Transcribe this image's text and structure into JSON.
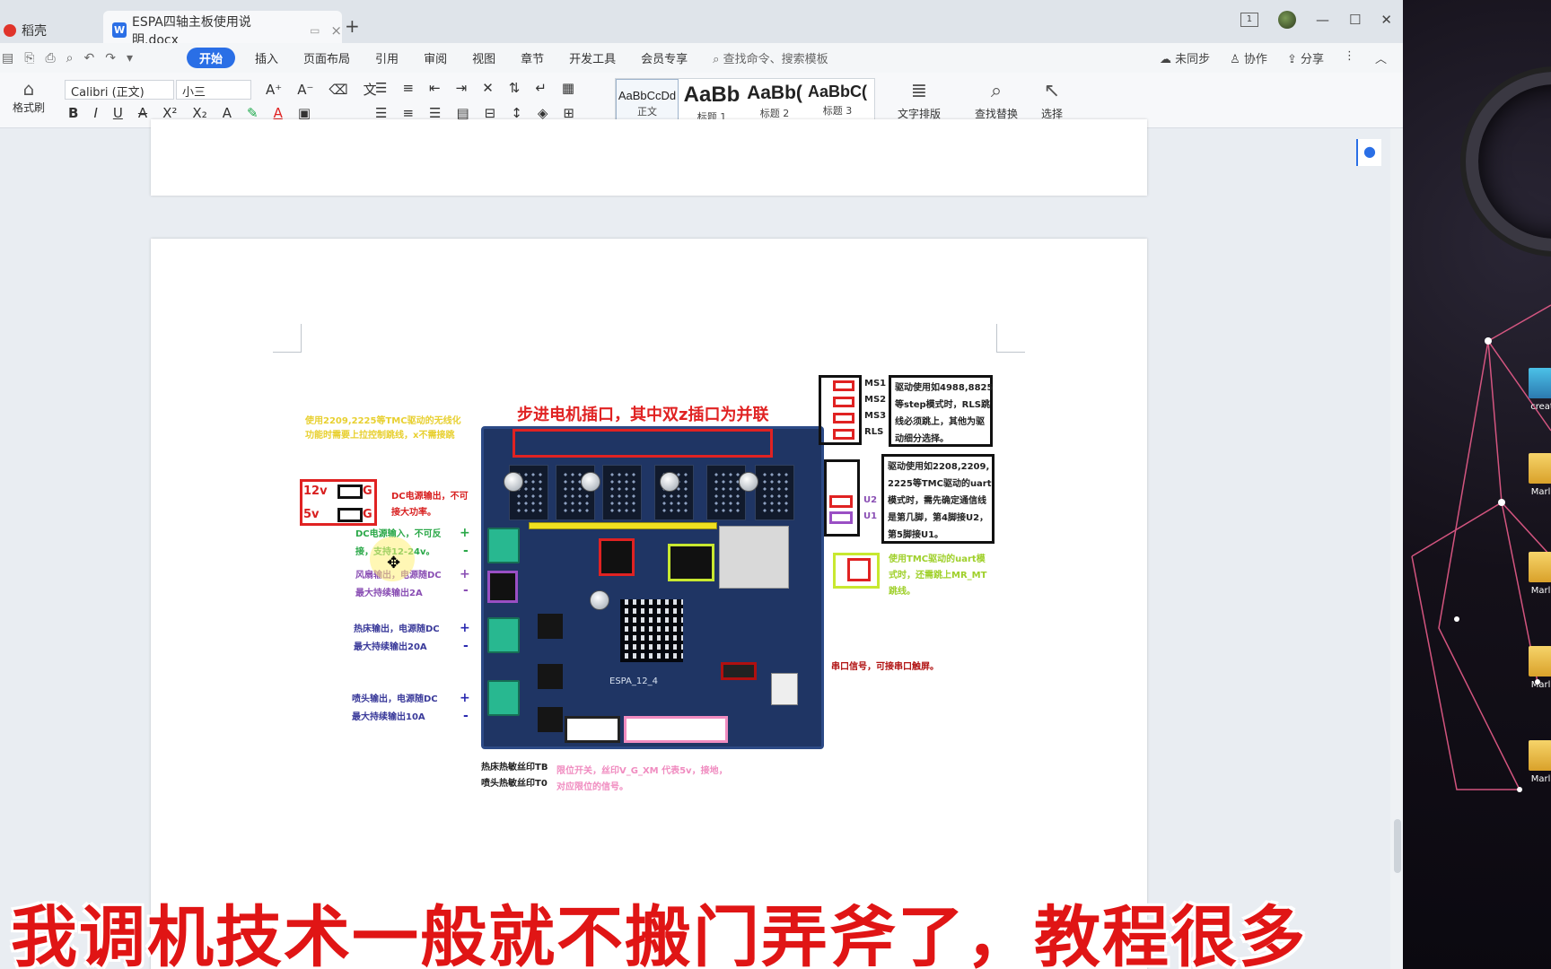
{
  "tabs": {
    "home_label": "稻壳",
    "doc_label": "ESPA四轴主板使用说明.docx",
    "new_tab": "+"
  },
  "window": {
    "minimize": "—",
    "maximize": "☐",
    "close": "✕",
    "layout_icon": "1"
  },
  "menu": {
    "items": [
      "开始",
      "插入",
      "页面布局",
      "引用",
      "审阅",
      "视图",
      "章节",
      "开发工具",
      "会员专享"
    ],
    "search_placeholder": "查找命令、搜索模板",
    "sync": "未同步",
    "collab": "协作",
    "share": "分享"
  },
  "ribbon": {
    "format_painter": "格式刷",
    "font_name": "Calibri (正文)",
    "font_size": "小三",
    "styles": [
      {
        "preview": "AaBbCcDd",
        "name": "正文"
      },
      {
        "preview": "AaBb",
        "name": "标题 1"
      },
      {
        "preview": "AaBb(",
        "name": "标题 2"
      },
      {
        "preview": "AaBbC(",
        "name": "标题 3"
      }
    ],
    "text_layout": "文字排版",
    "find_replace": "查找替换",
    "select": "选择"
  },
  "diagram": {
    "title": "步进电机插口，其中双z插口为并联",
    "board_name": "ESPA_12_4",
    "yellow_note_1": "使用2209,2225等TMC驱动的无线化",
    "yellow_note_2": "功能时需要上拉控制跳线，x不需接跳",
    "v12": "12v",
    "v5": "5v",
    "g": "G",
    "dc_out_1": "DC电源输出，不可",
    "dc_out_2": "接大功率。",
    "dc_in_1": "DC电源输入，不可反",
    "dc_in_2": "接，支持12-24v。",
    "fan_1": "风扇输出，电源随DC",
    "fan_2": "最大持续输出2A",
    "bed_1": "热床输出，电源随DC",
    "bed_2": "最大持续输出20A",
    "noz_1": "喷头输出，电源随DC",
    "noz_2": "最大持续输出10A",
    "plus": "+",
    "minus": "-",
    "ms1": "MS1",
    "ms2": "MS2",
    "ms3": "MS3",
    "rls": "RLS",
    "u2": "U2",
    "u1": "U1",
    "step_note_1": "驱动使用如4988,8825",
    "step_note_2": "等step模式时，RLS跳",
    "step_note_3": "线必须跳上，其他为驱",
    "step_note_4": "动细分选择。",
    "uart_note_1": "驱动使用如2208,2209,",
    "uart_note_2": "2225等TMC驱动的uart",
    "uart_note_3": "模式时，需先确定通信线",
    "uart_note_4": "是第几脚，第4脚接U2，",
    "uart_note_5": "第5脚接U1。",
    "green_note_1": "使用TMC驱动的uart模",
    "green_note_2": "式时，还需跳上MR_MT",
    "green_note_3": "跳线。",
    "serial_note": "串口信号，可接串口触屏。",
    "therm_bed": "热床热敏丝印TB",
    "therm_noz": "喷头热敏丝印T0",
    "endstop_1": "限位开关，丝印V_G_XM 代表5v，接地，",
    "endstop_2": "对应限位的信号。"
  },
  "subtitle": "我调机技术一般就不搬门弄斧了，教程很多",
  "desktop": {
    "icon1": "creat",
    "icon2": "Marli",
    "icon3": "Marli",
    "icon4": "Marli",
    "icon5": "Marli"
  },
  "colors": {
    "accent": "#2a6fe6",
    "subtitle_red": "#e01515",
    "pcb_blue": "#1f3564"
  }
}
